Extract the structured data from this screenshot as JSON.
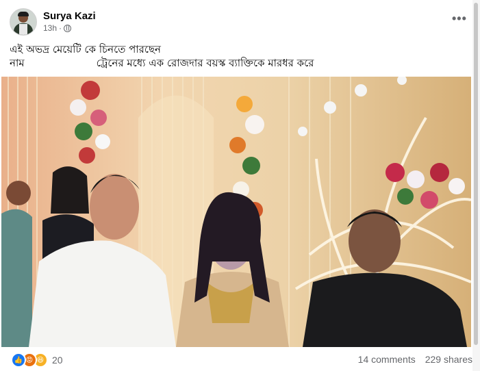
{
  "post": {
    "author": "Surya Kazi",
    "time": "13h",
    "separator": "·",
    "audience_icon": "globe-icon",
    "menu_icon": "more-horizontal-icon",
    "menu_label": "•••",
    "text_line1": "এই অভদ্র  মেয়েটি কে চিনতে পারছেন",
    "text_line2_part1": "নাম",
    "text_line2_part2": "ট্রেনের মধ্যে এক রোজদার বয়স্ক ব্যাক্তিকে মারধর করে"
  },
  "photo": {
    "description_icon": "wedding-stage-photo"
  },
  "footer": {
    "reactions": [
      "like-icon",
      "angry-icon",
      "haha-icon"
    ],
    "reaction_count": "20",
    "comments": "14 comments",
    "shares": "229 shares"
  },
  "colors": {
    "text": "#050505",
    "muted": "#65676b",
    "like": "#1877f2",
    "angry": "#e9710f",
    "haha": "#f7b125"
  }
}
